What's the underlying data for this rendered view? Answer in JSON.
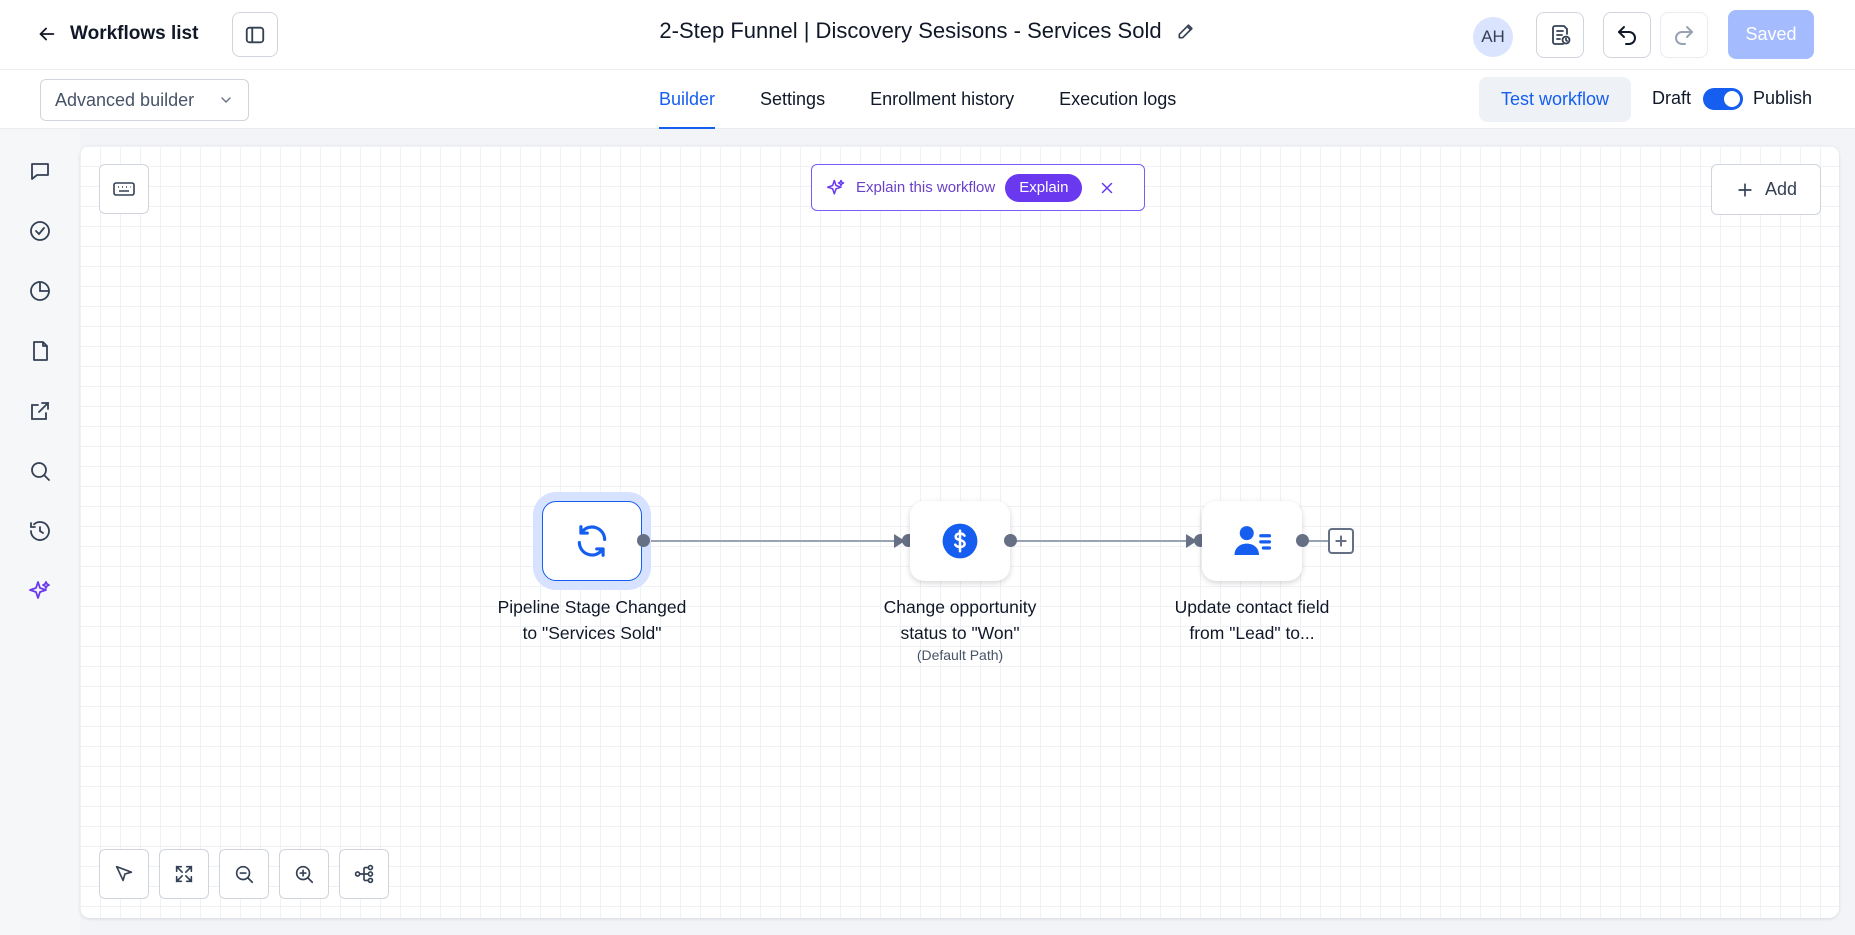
{
  "header": {
    "back_label": "Workflows list",
    "title": "2-Step Funnel | Discovery Sesisons - Services Sold",
    "avatar_initials": "AH",
    "saved_label": "Saved"
  },
  "subheader": {
    "builder_mode": "Advanced builder",
    "tabs": [
      {
        "label": "Builder",
        "active": true
      },
      {
        "label": "Settings",
        "active": false
      },
      {
        "label": "Enrollment history",
        "active": false
      },
      {
        "label": "Execution logs",
        "active": false
      }
    ],
    "test_label": "Test workflow",
    "draft_label": "Draft",
    "publish_label": "Publish",
    "publish_toggle_on": true
  },
  "sidebar": {
    "icons": [
      "chat-icon",
      "check-circle-icon",
      "pie-chart-icon",
      "file-icon",
      "external-link-icon",
      "search-icon",
      "history-icon",
      "sparkle-icon"
    ]
  },
  "canvas": {
    "explain_text": "Explain this workflow",
    "explain_button": "Explain",
    "add_label": "Add",
    "nodes": [
      {
        "label_line1": "Pipeline Stage Changed",
        "label_line2": "to \"Services Sold\"",
        "icon": "refresh-icon",
        "selected": true
      },
      {
        "label_line1": "Change opportunity",
        "label_line2": "status to \"Won\"",
        "sublabel": "(Default Path)",
        "icon": "dollar-icon",
        "selected": false
      },
      {
        "label_line1": "Update contact field",
        "label_line2": "from \"Lead\" to...",
        "icon": "contact-icon",
        "selected": false
      }
    ]
  },
  "colors": {
    "accent": "#155eef",
    "ai_purple": "#6938ef",
    "saved_disabled": "#a4bcfd"
  }
}
